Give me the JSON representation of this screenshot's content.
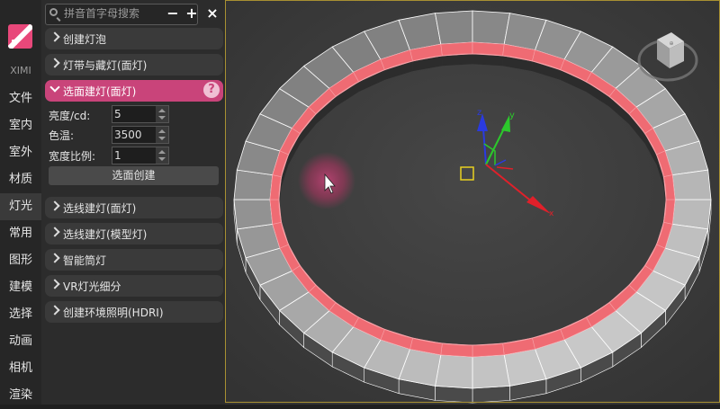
{
  "sidebar": {
    "brand": "XIMI",
    "items": [
      {
        "label": "文件"
      },
      {
        "label": "室内"
      },
      {
        "label": "室外"
      },
      {
        "label": "材质"
      },
      {
        "label": "灯光",
        "active": true
      },
      {
        "label": "常用"
      },
      {
        "label": "图形"
      },
      {
        "label": "建模"
      },
      {
        "label": "选择"
      },
      {
        "label": "动画"
      },
      {
        "label": "相机"
      },
      {
        "label": "渲染"
      }
    ]
  },
  "toolbar": {
    "search_placeholder": "拼音首字母搜索",
    "minus_glyph": "−",
    "plus_glyph": "+",
    "close_glyph": "×"
  },
  "sections": {
    "create_bulb": "创建灯泡",
    "strip_hidden": "灯带与藏灯(面灯)",
    "face_light": "选面建灯(面灯)",
    "line_face": "选线建灯(面灯)",
    "line_model": "选线建灯(模型灯)",
    "smart_tube": "智能筒灯",
    "vr_subdiv": "VR灯光细分",
    "hdri": "创建环境照明(HDRI)"
  },
  "face_light_panel": {
    "help_glyph": "?",
    "brightness_label": "亮度/cd:",
    "brightness_value": "5",
    "color_temp_label": "色温:",
    "color_temp_value": "3500",
    "width_ratio_label": "宽度比例:",
    "width_ratio_value": "1",
    "create_button": "选面创建"
  },
  "viewport": {
    "axis_x": "x",
    "axis_y": "y",
    "axis_z": "z",
    "ring_segments": 40,
    "colors": {
      "background": "#3b3b3b",
      "ring_face": "#c8c8c8",
      "ring_edge": "#ffffff",
      "ring_side": "#4a4a4a",
      "light_strip": "#ef6b73",
      "axis_x": "#e0202a",
      "axis_y": "#2cc82c",
      "axis_z": "#2a3ae0",
      "selection_box": "#e8d020",
      "viewport_border": "#a89032"
    }
  },
  "accent": "#c9447a"
}
